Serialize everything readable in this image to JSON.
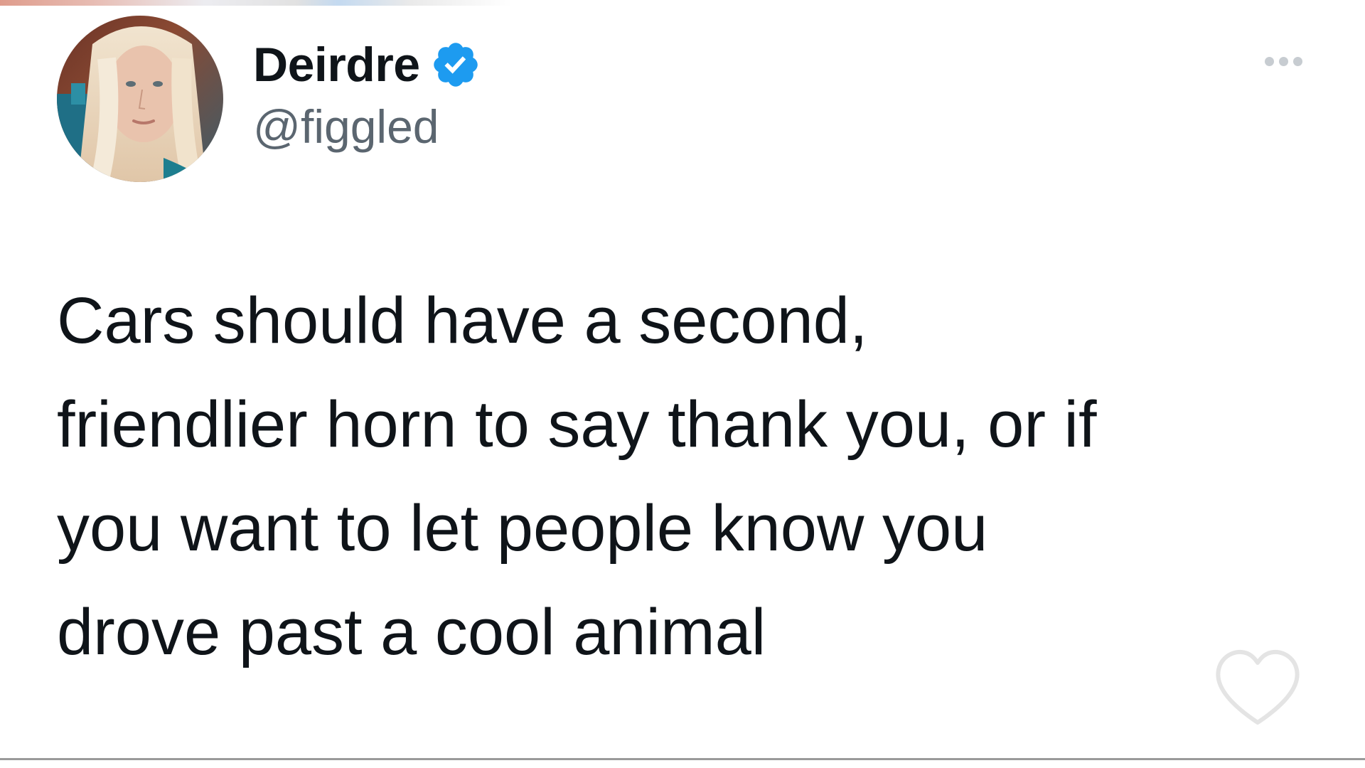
{
  "tweet": {
    "author": {
      "display_name": "Deirdre",
      "handle": "@figgled",
      "verified": true
    },
    "text": "Cars should have a second,\nfriendlier horn to say thank you, or if\nyou want to let people know you\ndrove past a cool animal"
  },
  "icons": {
    "verified": "verified-badge-icon",
    "more": "more-options-icon",
    "like": "heart-icon"
  },
  "colors": {
    "text": "#0f1419",
    "handle": "#5b6670",
    "verified": "#1d9bf0",
    "background": "#ffffff"
  }
}
